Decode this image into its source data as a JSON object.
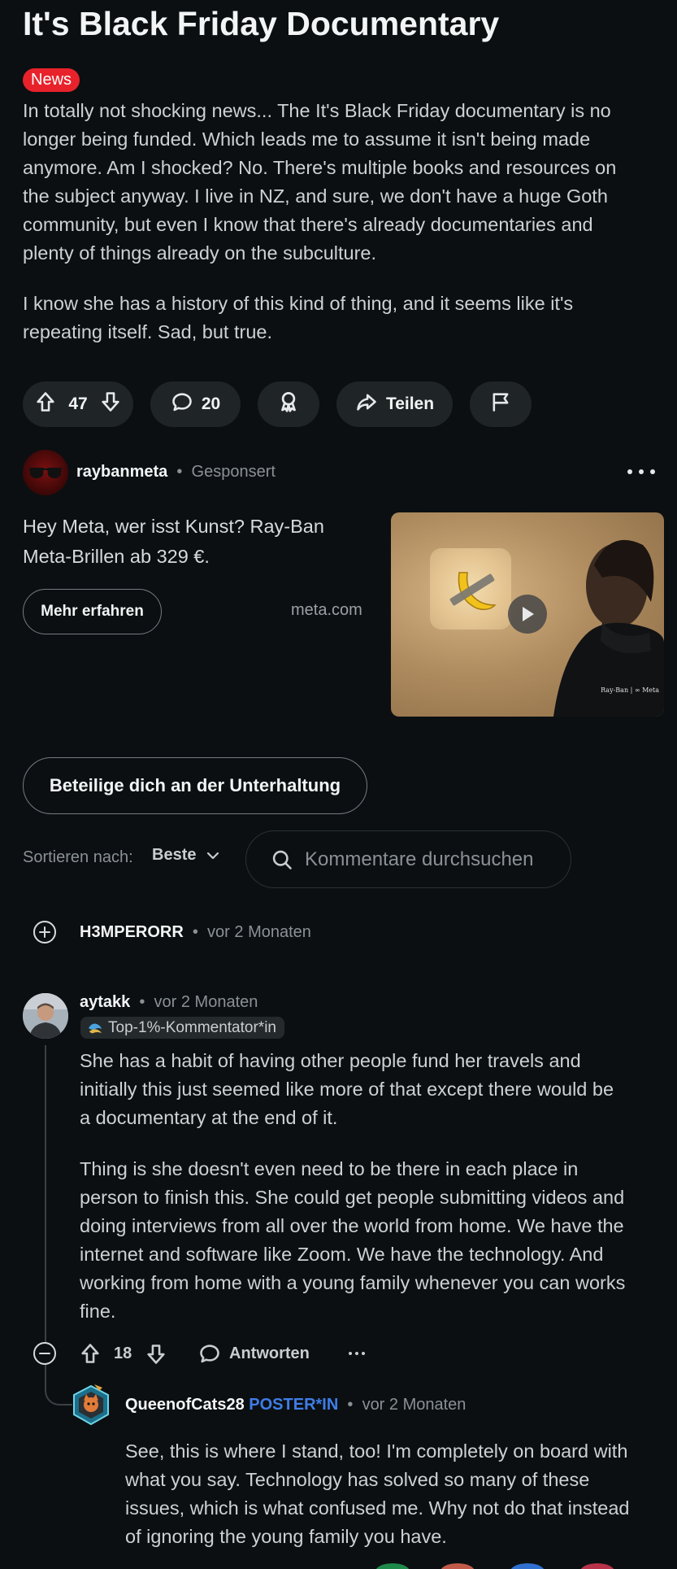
{
  "post": {
    "title": "It's Black Friday Documentary",
    "flair": "News",
    "para1_lines": [
      "In totally not shocking news... The It's Black Friday documentary is no",
      "longer being funded. Which leads me to assume it isn't being made",
      "anymore. Am I shocked? No. There's multiple books and resources on",
      "the subject anyway. I live in NZ, and sure, we don't have a huge Goth",
      "community, but even I know that there's already documentaries and",
      "plenty of things already on the subculture."
    ],
    "para2_lines": [
      "I know she has a history of this kind of thing, and it seems like it's",
      "repeating itself. Sad, but true."
    ],
    "votes": "47",
    "comments": "20",
    "share_label": "Teilen"
  },
  "ad": {
    "username": "raybanmeta",
    "sponsored": "Gesponsert",
    "text_lines": [
      "Hey Meta, wer isst Kunst? Ray-Ban",
      "Meta-Brillen ab 329 €."
    ],
    "cta": "Mehr erfahren",
    "domain": "meta.com",
    "watermark": "Ray-Ban | ∞ Meta"
  },
  "join_button": "Beteilige dich an der Unterhaltung",
  "sort": {
    "label": "Sortieren nach:",
    "value": "Beste"
  },
  "search": {
    "placeholder": "Kommentare durchsuchen"
  },
  "comments": {
    "collapsed": {
      "username": "H3MPERORR",
      "time": "vor 2 Monaten"
    },
    "c1": {
      "username": "aytakk",
      "time": "vor 2 Monaten",
      "badge": "Top-1%-Kommentator*in",
      "p1_lines": [
        "She has a habit of having other people fund her travels and",
        "initially this just seemed like more of that except there would be",
        "a documentary at the end of it."
      ],
      "p2_lines": [
        "Thing is she doesn't even need to be there in each place in",
        "person to finish this. She could get people submitting videos and",
        "doing interviews from all over the world from home. We have the",
        "internet and software like Zoom. We have the technology. And",
        "working from home with a young family whenever you can works",
        "fine."
      ],
      "votes": "18",
      "reply_label": "Antworten"
    },
    "c2": {
      "username": "QueenofCats28",
      "poster_tag": "POSTER*IN",
      "time": "vor 2 Monaten",
      "lines": [
        "See, this is where I stand, too! I'm completely on board with",
        "what you say. Technology has solved so many of these",
        "issues, which is what confused me. Why not do that instead",
        "of ignoring the young family you have."
      ]
    }
  },
  "colors": {
    "background": "#0b0f12",
    "pill": "#1f2426",
    "flair": "#e8222b",
    "poster_tag": "#3f7de8"
  }
}
